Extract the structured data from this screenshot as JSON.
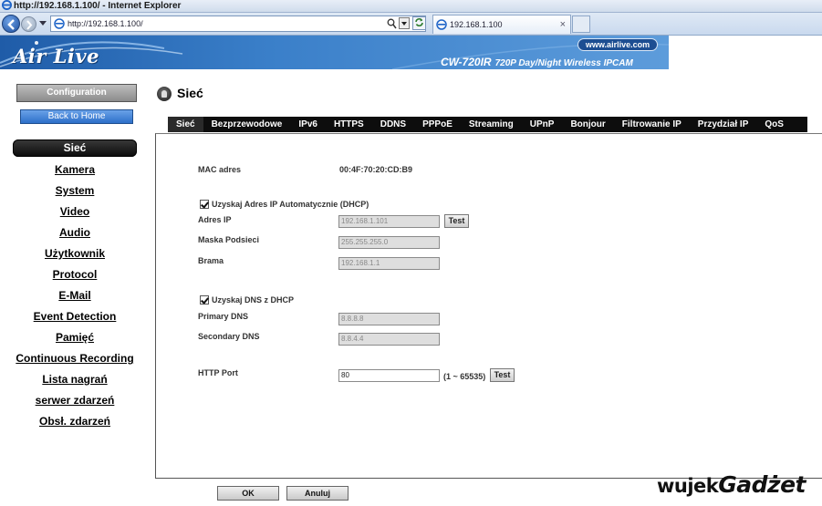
{
  "browser": {
    "window_title": "http://192.168.1.100/ - Internet Explorer",
    "url": "http://192.168.1.100/",
    "tab_title": "192.168.1.100",
    "tab_close": "×"
  },
  "banner": {
    "logo": "Air Live",
    "site": "www.airlive.com",
    "model": "CW-720IR",
    "model_desc": "720P Day/Night Wireless IPCAM"
  },
  "sidebar": {
    "configuration_label": "Configuration",
    "back_label": "Back to Home",
    "items": [
      {
        "label": "Sieć",
        "active": true
      },
      {
        "label": "Kamera"
      },
      {
        "label": "System"
      },
      {
        "label": "Video"
      },
      {
        "label": "Audio"
      },
      {
        "label": "Użytkownik"
      },
      {
        "label": "Protocol"
      },
      {
        "label": "E-Mail"
      },
      {
        "label": "Event Detection"
      },
      {
        "label": "Pamięć"
      },
      {
        "label": "Continuous Recording"
      },
      {
        "label": "Lista nagrań"
      },
      {
        "label": "serwer zdarzeń"
      },
      {
        "label": "Obsł. zdarzeń"
      }
    ]
  },
  "page": {
    "title": "Sieć"
  },
  "tabs": [
    "Sieć",
    "Bezprzewodowe",
    "IPv6",
    "HTTPS",
    "DDNS",
    "PPPoE",
    "Streaming",
    "UPnP",
    "Bonjour",
    "Filtrowanie IP",
    "Przydział IP",
    "QoS"
  ],
  "form": {
    "mac_label": "MAC adres",
    "mac_value": "00:4F:70:20:CD:B9",
    "dhcp_label": "Uzyskaj Adres IP Automatycznie (DHCP)",
    "dhcp_checked": true,
    "ip_label": "Adres IP",
    "ip_value": "192.168.1.101",
    "mask_label": "Maska Podsieci",
    "mask_value": "255.255.255.0",
    "gateway_label": "Brama",
    "gateway_value": "192.168.1.1",
    "dns_dhcp_label": "Uzyskaj DNS z DHCP",
    "dns_dhcp_checked": true,
    "primary_dns_label": "Primary DNS",
    "primary_dns_value": "8.8.8.8",
    "secondary_dns_label": "Secondary DNS",
    "secondary_dns_value": "8.8.4.4",
    "http_port_label": "HTTP Port",
    "http_port_value": "80",
    "http_port_range": "(1 ~ 65535)",
    "test_label": "Test"
  },
  "footer": {
    "ok_label": "OK",
    "cancel_label": "Anuluj"
  },
  "watermark": {
    "part1": "wujek",
    "part2": "Gadżet"
  },
  "colors": {
    "banner_blue": "#3a7fc9",
    "tabstrip": "#0d0d0d",
    "back_button": "#2d6fc9"
  }
}
